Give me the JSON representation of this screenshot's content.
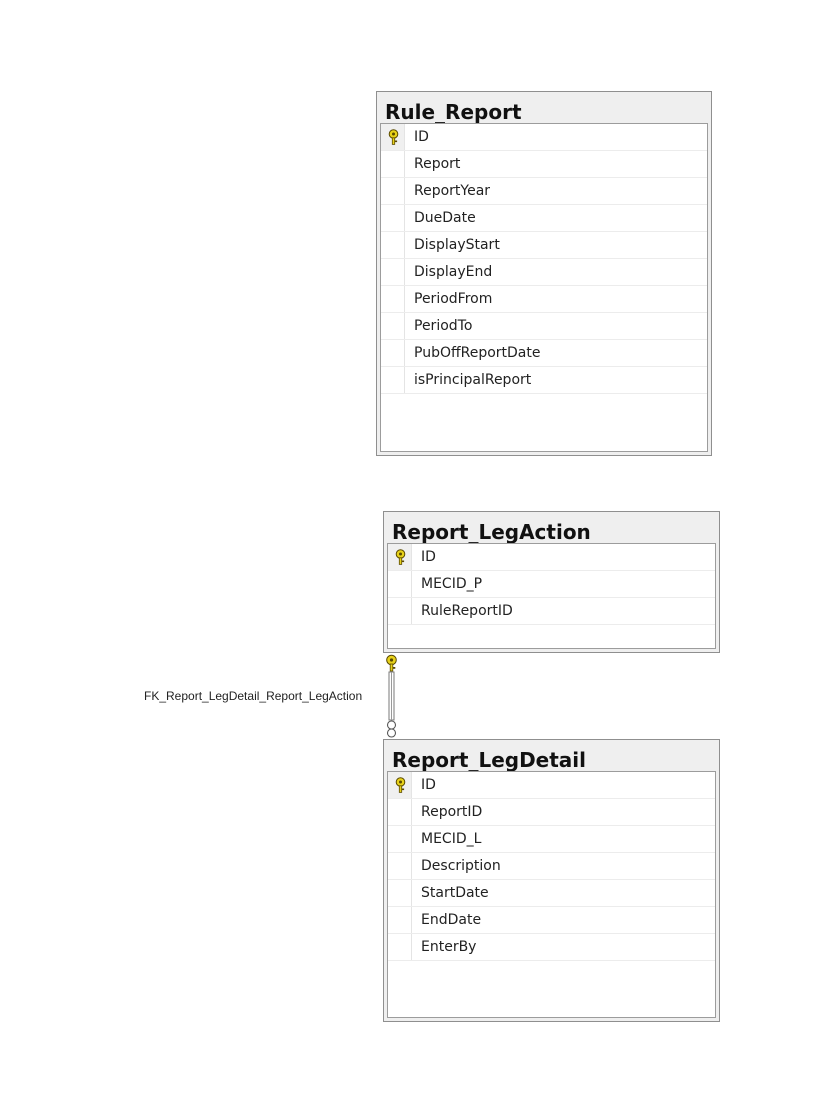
{
  "tables": [
    {
      "name": "Rule_Report",
      "fields": [
        {
          "name": "ID",
          "primary_key": true
        },
        {
          "name": "Report",
          "primary_key": false
        },
        {
          "name": "ReportYear",
          "primary_key": false
        },
        {
          "name": "DueDate",
          "primary_key": false
        },
        {
          "name": "DisplayStart",
          "primary_key": false
        },
        {
          "name": "DisplayEnd",
          "primary_key": false
        },
        {
          "name": "PeriodFrom",
          "primary_key": false
        },
        {
          "name": "PeriodTo",
          "primary_key": false
        },
        {
          "name": "PubOffReportDate",
          "primary_key": false
        },
        {
          "name": "isPrincipalReport",
          "primary_key": false
        }
      ]
    },
    {
      "name": "Report_LegAction",
      "fields": [
        {
          "name": "ID",
          "primary_key": true
        },
        {
          "name": "MECID_P",
          "primary_key": false
        },
        {
          "name": "RuleReportID",
          "primary_key": false
        }
      ]
    },
    {
      "name": "Report_LegDetail",
      "fields": [
        {
          "name": "ID",
          "primary_key": true
        },
        {
          "name": "ReportID",
          "primary_key": false
        },
        {
          "name": "MECID_L",
          "primary_key": false
        },
        {
          "name": "Description",
          "primary_key": false
        },
        {
          "name": "StartDate",
          "primary_key": false
        },
        {
          "name": "EndDate",
          "primary_key": false
        },
        {
          "name": "EnterBy",
          "primary_key": false
        }
      ]
    }
  ],
  "relationships": [
    {
      "name": "FK_Report_LegDetail_Report_LegAction",
      "from_table": "Report_LegAction",
      "to_table": "Report_LegDetail",
      "from_end": "key",
      "to_end": "infinity"
    }
  ],
  "colors": {
    "key_icon": "#e8d21a",
    "key_outline": "#5a4a00",
    "relationship_line": "#7a7a7a"
  }
}
